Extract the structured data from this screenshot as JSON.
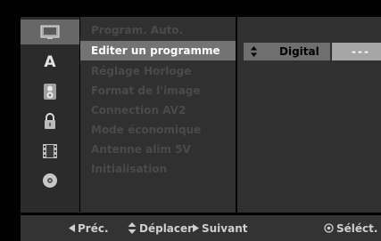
{
  "sidebar": {
    "icons": [
      {
        "name": "monitor-icon",
        "active": true
      },
      {
        "name": "language-a-icon",
        "letter": "A",
        "active": false
      },
      {
        "name": "audio-icon",
        "active": false
      },
      {
        "name": "lock-icon",
        "active": false
      },
      {
        "name": "film-icon",
        "active": false
      },
      {
        "name": "disc-icon",
        "active": false
      }
    ]
  },
  "menu": {
    "items": [
      {
        "label": "Program. Auto.",
        "active": false
      },
      {
        "label": "Editer un programme",
        "active": true
      },
      {
        "label": "Réglage Horloge",
        "active": false
      },
      {
        "label": "Format de l'image",
        "active": false
      },
      {
        "label": "Connection AV2",
        "active": false
      },
      {
        "label": "Mode économique",
        "active": false
      },
      {
        "label": "Antenne alim 5V",
        "active": false
      },
      {
        "label": "Initialisation",
        "active": false
      }
    ]
  },
  "option": {
    "arrow_icon": "up-down-icon",
    "label": "Digital",
    "value": "---"
  },
  "footer": {
    "prev": {
      "icon": "left-arrow-icon",
      "label": "Préc."
    },
    "move": {
      "icon": "up-down-icon",
      "label": "Déplacer"
    },
    "next": {
      "icon": "right-arrow-icon",
      "label": "Suivant"
    },
    "select": {
      "icon": "select-circle-icon",
      "label": "Séléct."
    }
  },
  "colors": {
    "background": "#000000",
    "panel": "#303030",
    "highlight": "#737373",
    "value_box": "#a6a6a6"
  }
}
